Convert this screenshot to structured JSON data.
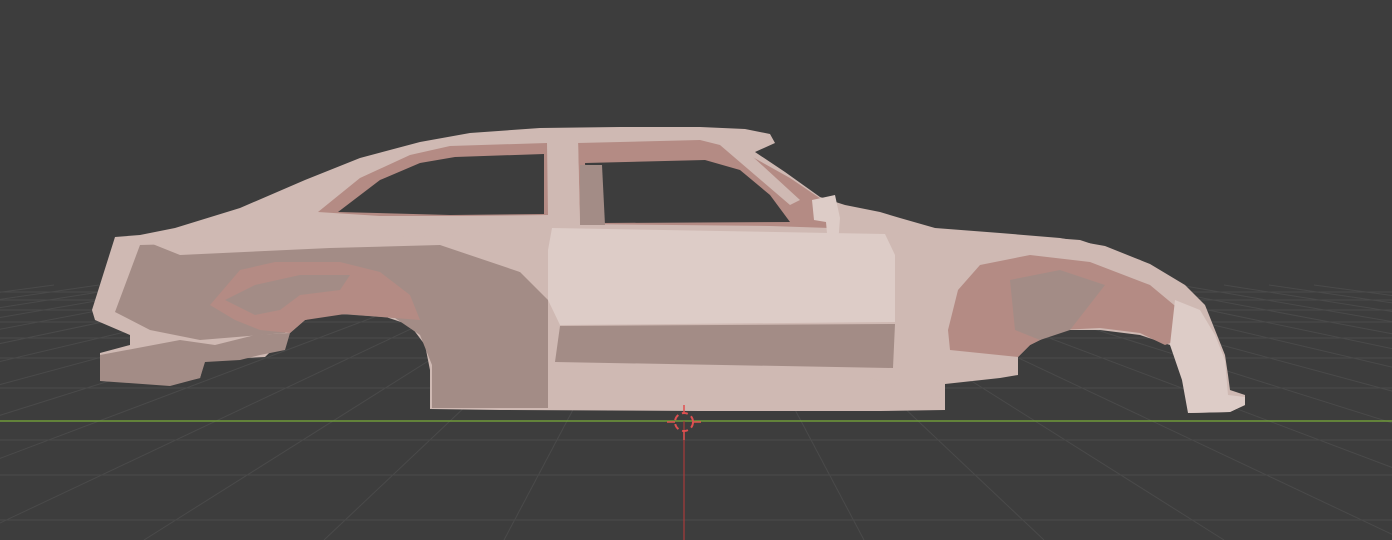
{
  "viewport": {
    "mode": "3d-viewport",
    "background_color": "#3d3d3d",
    "grid_line_color": "#4a4a4a",
    "x_axis_color": "#6f9a3a",
    "z_axis_color": "#a83a3a",
    "cursor_color": "#e05050"
  },
  "object": {
    "kind": "car-body-shell-mesh",
    "view": "side",
    "shading": "solid",
    "base_color": "#cfb9b3",
    "shadow_color": "#a38c86",
    "highlight_color": "#ddccc7",
    "cavity_color": "#b48b84"
  },
  "icons": {
    "cursor": "3d-cursor-icon",
    "grid": "floor-grid",
    "axis": "axis-line"
  }
}
